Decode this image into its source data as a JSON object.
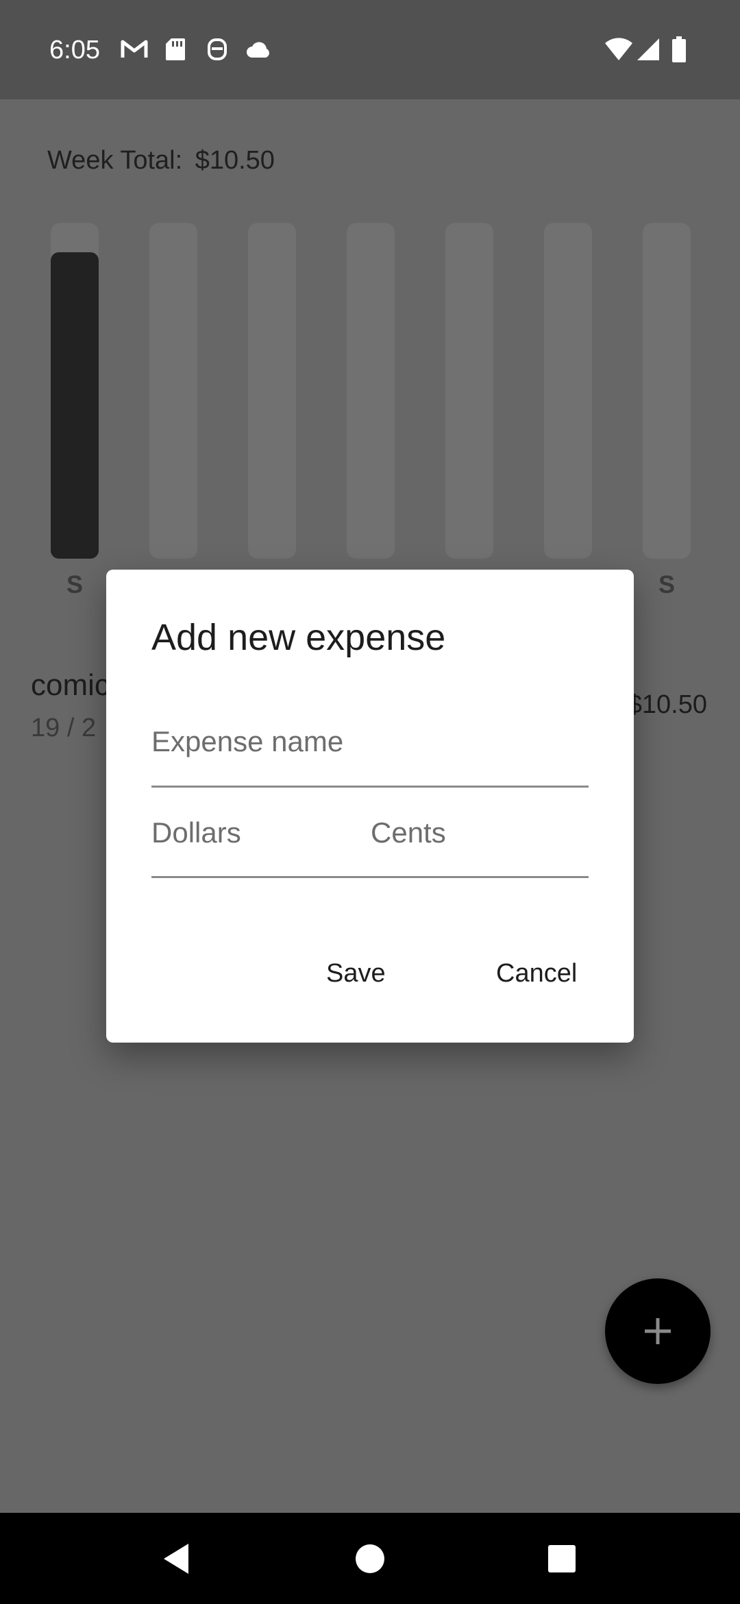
{
  "status_bar": {
    "time": "6:05",
    "left_icons": [
      "gmail-icon",
      "sd-card-icon",
      "bug-icon",
      "cloud-icon"
    ],
    "right_icons": [
      "wifi-icon",
      "signal-icon",
      "battery-icon"
    ]
  },
  "summary": {
    "week_total_label": "Week Total:",
    "week_total_value": "$10.50"
  },
  "chart_data": {
    "type": "bar",
    "categories": [
      "S",
      "",
      "",
      "",
      "",
      "",
      "S"
    ],
    "values": [
      10.5,
      0,
      0,
      0,
      0,
      0,
      0
    ],
    "ylim": [
      0,
      11.5
    ]
  },
  "expense_list": [
    {
      "name": "comic",
      "date": "19 / 2",
      "amount": "$10.50"
    }
  ],
  "dialog": {
    "title": "Add new expense",
    "name_placeholder": "Expense name",
    "dollars_placeholder": "Dollars",
    "cents_placeholder": "Cents",
    "save_label": "Save",
    "cancel_label": "Cancel"
  },
  "fab": {
    "icon": "plus-icon"
  },
  "nav_bar": {
    "icons": [
      "back-icon",
      "home-icon",
      "recents-icon"
    ]
  },
  "colors": {
    "bar_fill": "#222222",
    "bar_track": "#717171",
    "scrim": "#666666",
    "dialog_bg": "#ffffff"
  }
}
